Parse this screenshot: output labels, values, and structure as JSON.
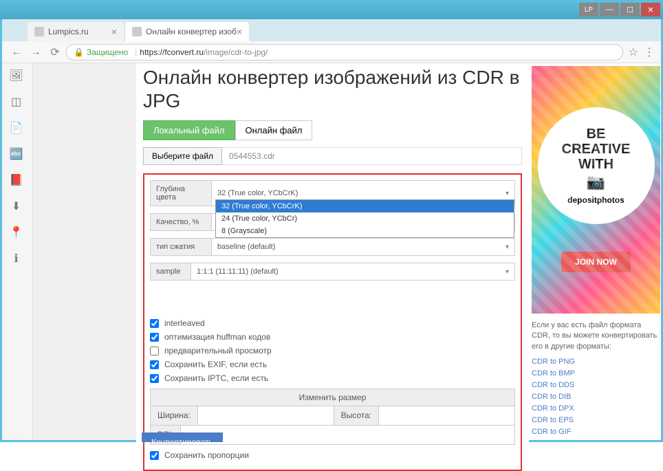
{
  "window": {
    "min": "—",
    "max": "☐",
    "close": "✕",
    "lp": "LP"
  },
  "tabs": [
    {
      "label": "Lumpics.ru",
      "active": false
    },
    {
      "label": "Онлайн конвертер изоб",
      "active": true
    }
  ],
  "address": {
    "secure": "Защищено",
    "host": "https://fconvert.ru",
    "path": "/image/cdr-to-jpg/"
  },
  "page": {
    "title": "Онлайн конвертер изображений из CDR в JPG",
    "source_local": "Локальный файл",
    "source_online": "Онлайн файл",
    "choose_file": "Выберите файл",
    "filename": "0544553.cdr",
    "convert_btn": "Конвертировать"
  },
  "options": {
    "depth_label": "Глубина цвета",
    "depth_value": "32 (True color, YCbCrK)",
    "depth_options": [
      "32 (True color, YCbCrK)",
      "24 (True color, YCbCr)",
      "8 (Grayscale)"
    ],
    "quality_label": "Качество, %",
    "compression_label": "тип сжатия",
    "compression_value": "baseline (default)",
    "sample_label": "sample",
    "sample_value": "1:1:1 (11:11:11) (default)",
    "checks": [
      {
        "label": "interleaved",
        "checked": true
      },
      {
        "label": "оптимизация huffman кодов",
        "checked": true
      },
      {
        "label": "предварительный просмотр",
        "checked": false
      },
      {
        "label": "Сохранить EXIF, если есть",
        "checked": true
      },
      {
        "label": "Сохранить IPTC, если есть",
        "checked": true
      }
    ],
    "resize_header": "Изменить размер",
    "width_label": "Ширина:",
    "height_label": "Высота:",
    "dpi_label": "DPI:",
    "keep_prop": "Сохранить пропорции"
  },
  "sidebar": {
    "ad_line1": "BE",
    "ad_line2": "CREATIVE",
    "ad_line3": "WITH",
    "ad_brand": "depositphotos",
    "ad_cta": "JOIN NOW",
    "info_text": "Если у вас есть файл формата CDR, то вы можете конвертировать его в другие форматы:",
    "links": [
      "CDR to PNG",
      "CDR to BMP",
      "CDR to DDS",
      "CDR to DIB",
      "CDR to DPX",
      "CDR to EPS",
      "CDR to GIF"
    ]
  }
}
